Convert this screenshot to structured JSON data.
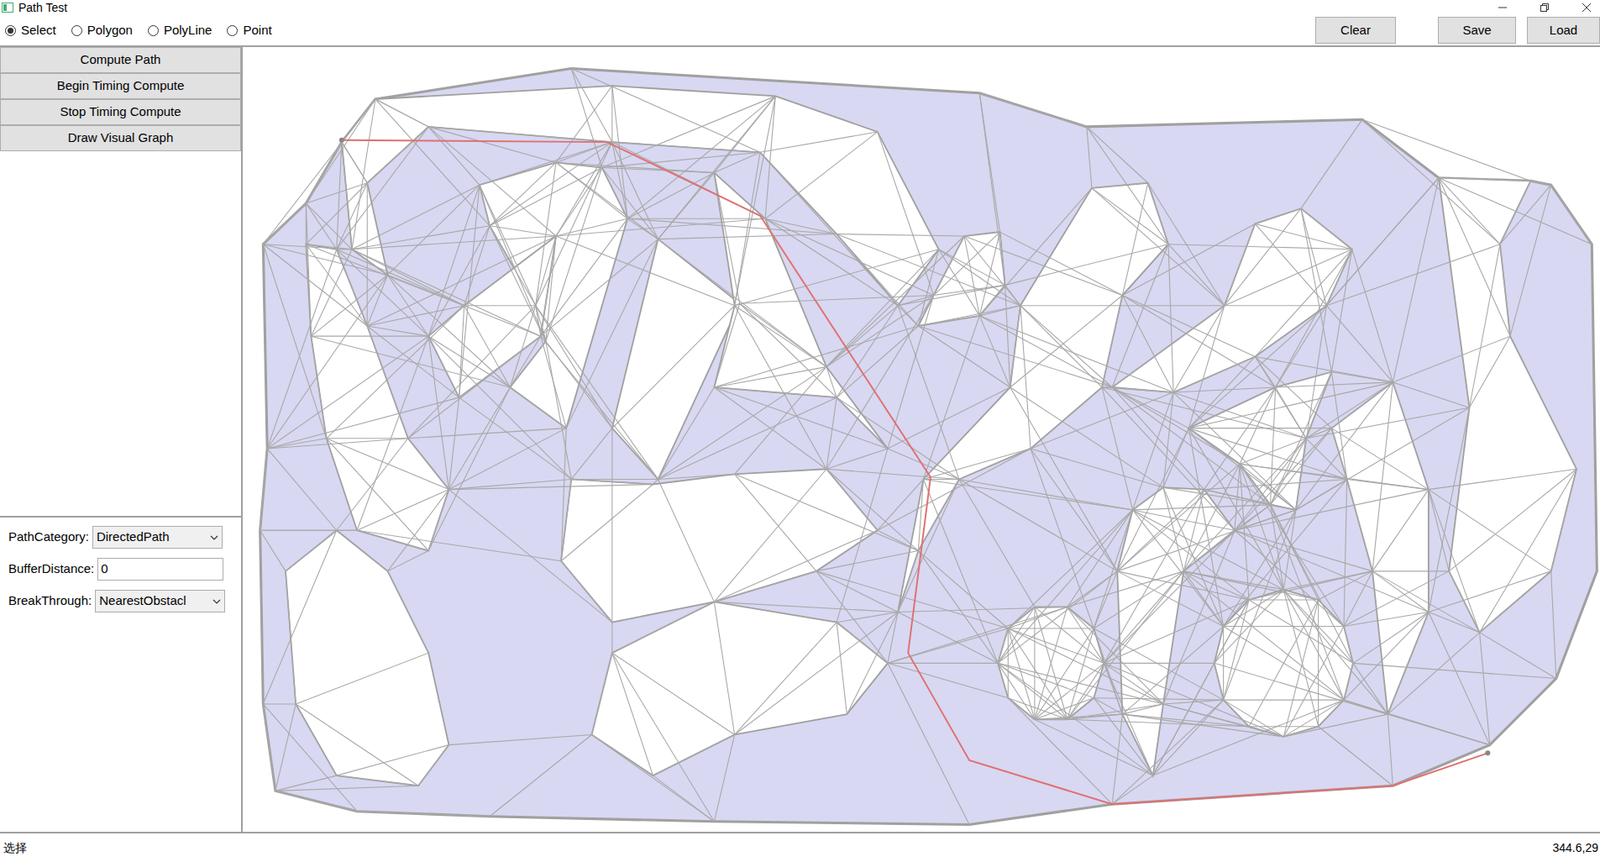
{
  "window": {
    "title": "Path Test"
  },
  "modes": [
    {
      "label": "Select",
      "selected": true
    },
    {
      "label": "Polygon",
      "selected": false
    },
    {
      "label": "PolyLine",
      "selected": false
    },
    {
      "label": "Point",
      "selected": false
    }
  ],
  "toolbar_buttons": [
    "Clear",
    "Save",
    "Load"
  ],
  "sidebar": {
    "buttons": [
      "Compute Path",
      "Begin Timing Compute",
      "Stop Timing Compute",
      "Draw Visual Graph"
    ]
  },
  "properties": [
    {
      "label": "PathCategory:",
      "value": "DirectedPath",
      "kind": "select"
    },
    {
      "label": "BufferDistance:",
      "value": "0",
      "kind": "input"
    },
    {
      "label": "BreakThrough:",
      "value": "NearestObstacl",
      "kind": "select"
    }
  ],
  "status_bar": {
    "text": "选择",
    "coords": "344.6,29"
  }
}
